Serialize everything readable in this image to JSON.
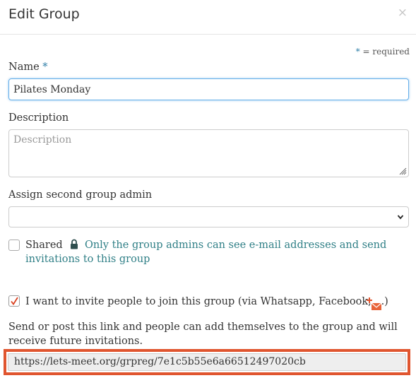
{
  "header": {
    "title": "Edit Group",
    "close_label": "×"
  },
  "required_note": {
    "star": "*",
    "text": " = required"
  },
  "form": {
    "name": {
      "label": "Name",
      "required_star": "*",
      "value": "Pilates Monday"
    },
    "description": {
      "label": "Description",
      "value": "",
      "placeholder": "Description"
    },
    "second_admin": {
      "label": "Assign second group admin",
      "value": ""
    },
    "shared": {
      "label": "Shared",
      "checked": false,
      "note_line1": "Only the group admins can see e-mail addresses and send",
      "note_line2": "invitations to this group"
    },
    "invite": {
      "label": "I want to invite people to join this group (via Whatsapp, Facebook, ...)",
      "checked": true
    },
    "link_info": "Send or post this link and people can add themselves to the group and will receive future invitations.",
    "link_url": "https://lets-meet.org/grpreg/7e1c5b55e6a66512497020cb"
  },
  "colors": {
    "accent_blue": "#2f7fa8",
    "note_teal": "#2f7f86",
    "highlight": "#e0552f",
    "checkmark": "#d9401f"
  },
  "icons": {
    "close": "close-icon",
    "lock": "lock-icon",
    "invite": "invite-envelope-icon",
    "chevron": "chevron-down-icon",
    "resize": "resize-grip-icon",
    "check": "checkmark-icon"
  }
}
